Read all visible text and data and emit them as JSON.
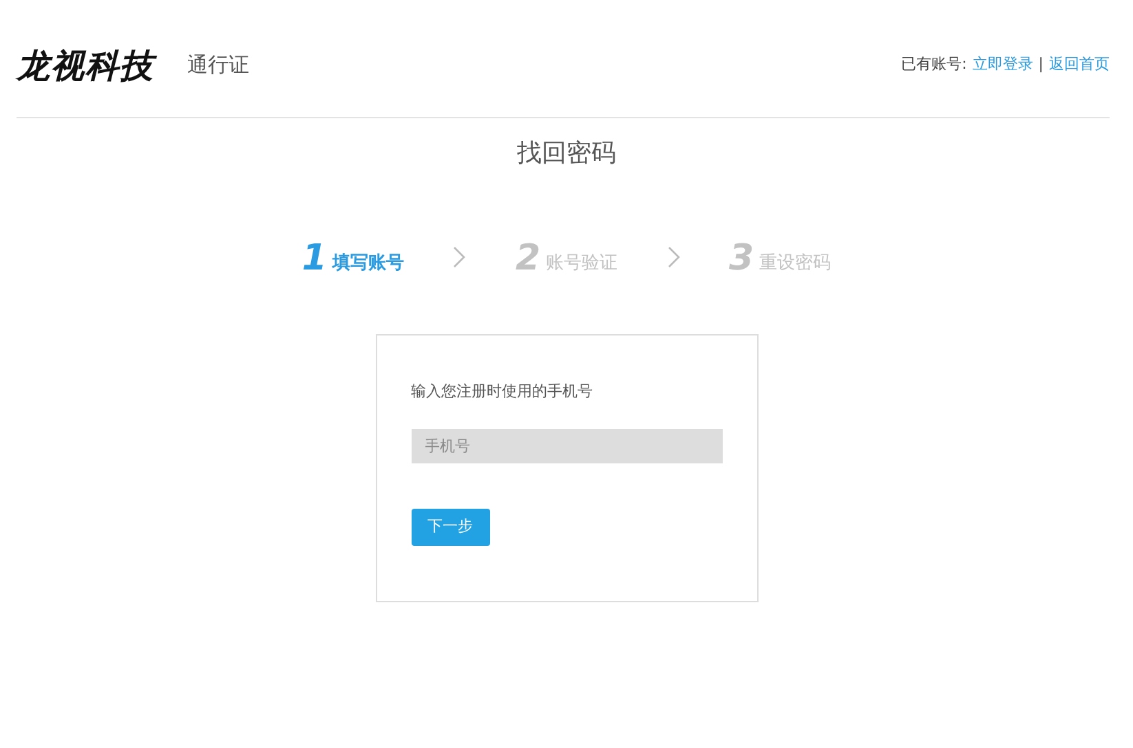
{
  "header": {
    "logo": "龙视科技",
    "subtitle": "通行证",
    "account_prompt": "已有账号:",
    "login_link": "立即登录",
    "separator": "|",
    "home_link": "返回首页"
  },
  "page_title": "找回密码",
  "steps": [
    {
      "number": "1",
      "label": "填写账号",
      "selected": true
    },
    {
      "number": "2",
      "label": "账号验证",
      "selected": false
    },
    {
      "number": "3",
      "label": "重设密码",
      "selected": false
    }
  ],
  "form": {
    "instruction": "输入您注册时使用的手机号",
    "phone": {
      "placeholder": "手机号"
    },
    "next_button": "下一步"
  }
}
